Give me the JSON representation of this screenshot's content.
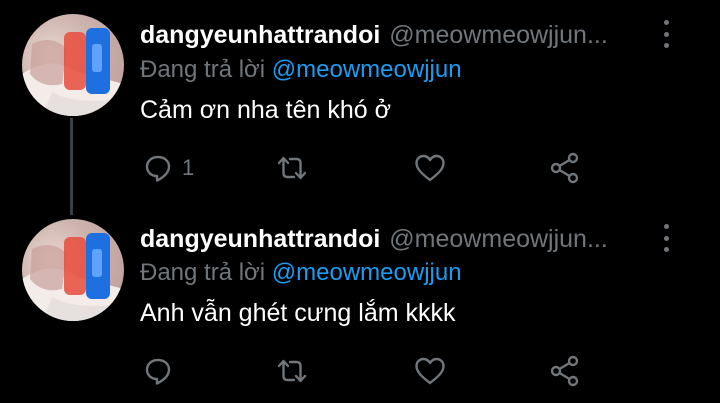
{
  "tweets": [
    {
      "display_name": "dangyeunhattrandoi",
      "handle": "@meowmeowjjun...",
      "replying_prefix": "Đang trả lời",
      "replying_to": "@meowmeowjjun",
      "text": "Cảm ơn nha tên khó ở",
      "reply_count": "1"
    },
    {
      "display_name": "dangyeunhattrandoi",
      "handle": "@meowmeowjjun...",
      "replying_prefix": "Đang trả lời",
      "replying_to": "@meowmeowjjun",
      "text": "Anh vẫn ghét cưng lắm kkkk",
      "reply_count": ""
    }
  ],
  "icons": {
    "reply": "reply-icon",
    "retweet": "retweet-icon",
    "like": "heart-icon",
    "share": "share-icon",
    "more": "more-icon"
  },
  "colors": {
    "background": "#000000",
    "text": "#ffffff",
    "secondary": "#71767b",
    "mention": "#1d9bf0"
  }
}
